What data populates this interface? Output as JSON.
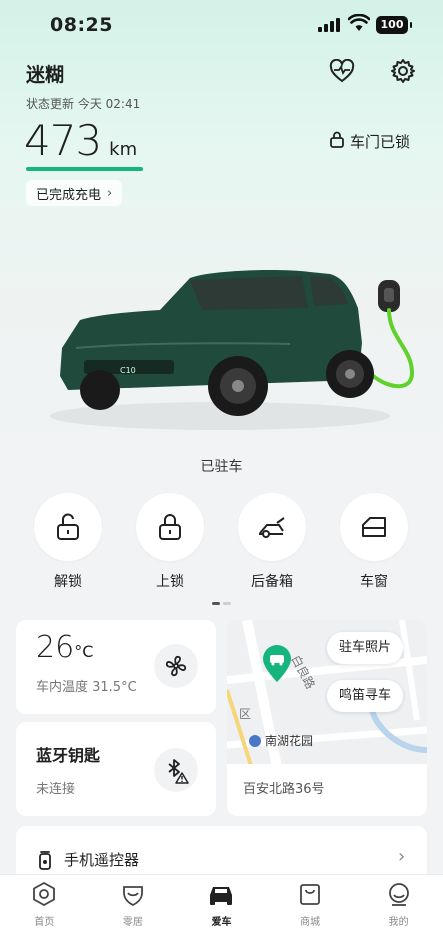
{
  "status_bar": {
    "time": "08:25",
    "battery": "100"
  },
  "header": {
    "car_name": "迷糊",
    "update_text": "状态更新 今天 02:41",
    "range_value": "473",
    "range_unit": "km",
    "door_status": "车门已锁",
    "charge_status": "已完成充电"
  },
  "car": {
    "badge": "C10",
    "state": "已驻车"
  },
  "controls": [
    {
      "label": "解锁",
      "icon": "unlock-icon"
    },
    {
      "label": "上锁",
      "icon": "lock-icon"
    },
    {
      "label": "后备箱",
      "icon": "trunk-icon"
    },
    {
      "label": "车窗",
      "icon": "window-icon"
    }
  ],
  "climate": {
    "temp_value": "26",
    "temp_unit": "°C",
    "inside_text": "车内温度 31.5°C"
  },
  "bluetooth": {
    "title": "蓝牙钥匙",
    "status": "未连接"
  },
  "map": {
    "photo_button": "驻车照片",
    "honk_button": "鸣笛寻车",
    "road_label": "白良路",
    "poi_label": "南湖花园",
    "district_label": "区",
    "address": "百安北路36号"
  },
  "remote": {
    "label": "手机遥控器"
  },
  "tabs": [
    {
      "label": "首页",
      "icon": "home-icon"
    },
    {
      "label": "零居",
      "icon": "heart-shield-icon"
    },
    {
      "label": "爱车",
      "icon": "car-icon"
    },
    {
      "label": "商城",
      "icon": "shop-bag-icon"
    },
    {
      "label": "我的",
      "icon": "profile-icon"
    }
  ],
  "colors": {
    "accent": "#16b57d",
    "car_body": "#1f4a3c",
    "cable": "#5fd12c"
  }
}
